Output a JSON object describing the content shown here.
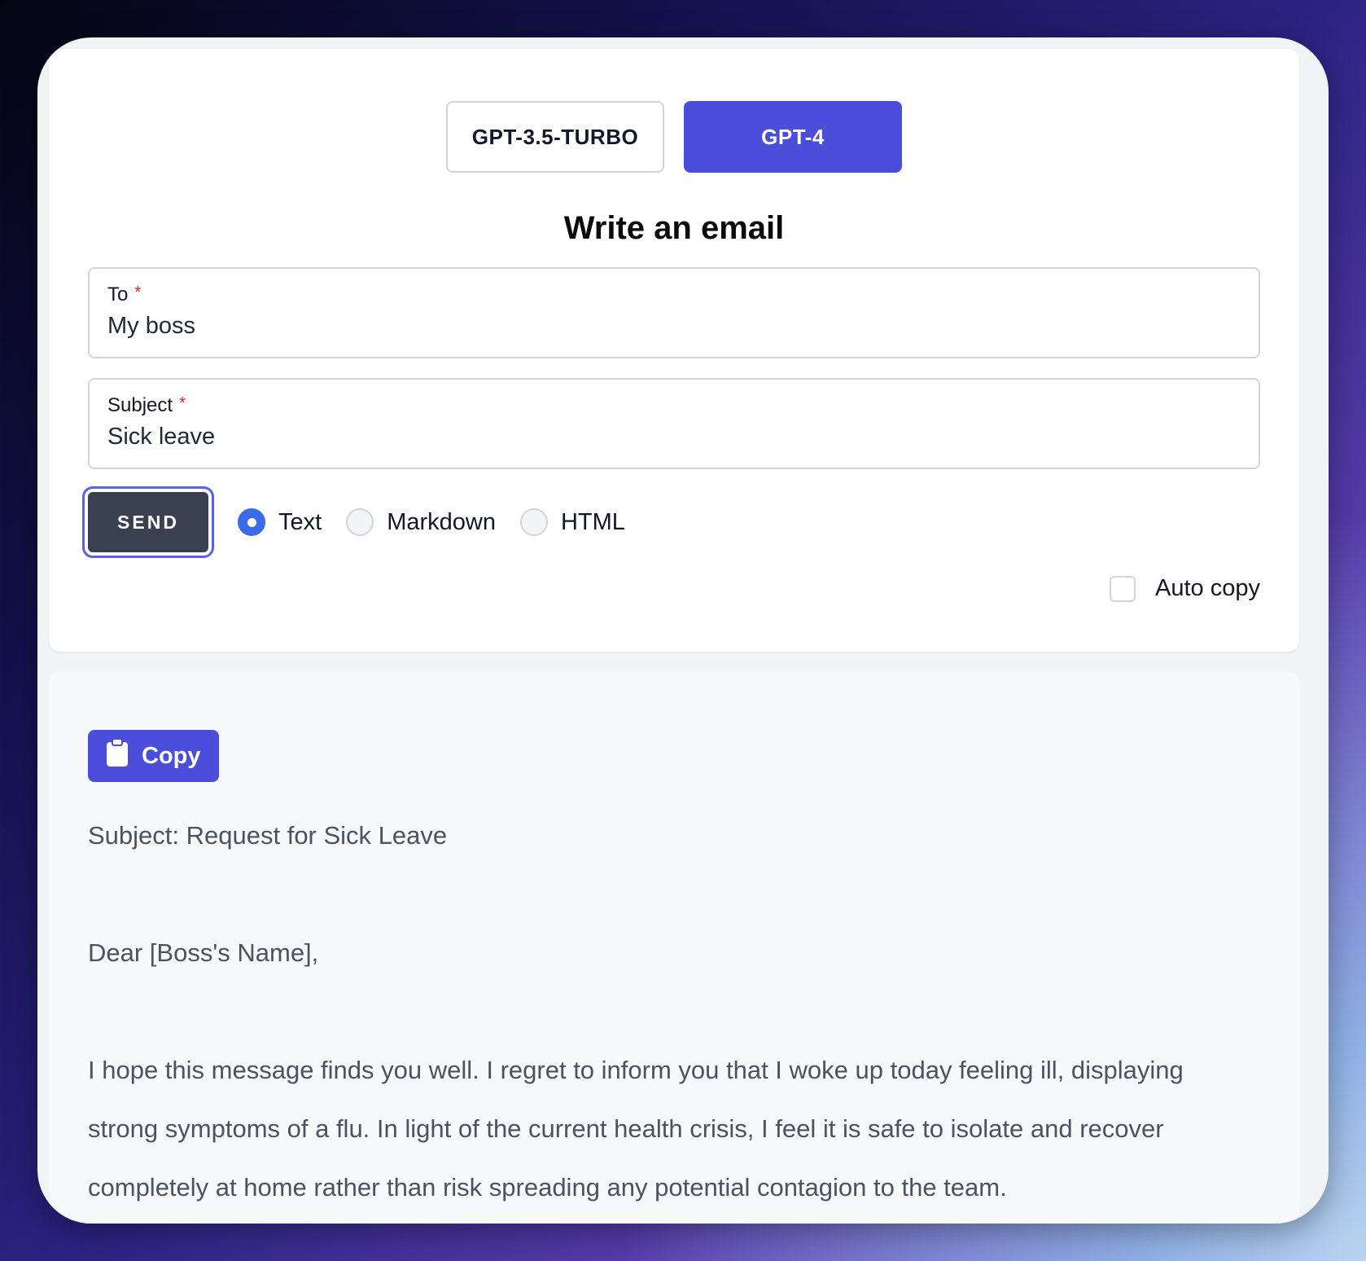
{
  "models": {
    "option_a": "GPT-3.5-TURBO",
    "option_b": "GPT-4",
    "selected": "GPT-4"
  },
  "form": {
    "title": "Write an email",
    "to": {
      "label": "To",
      "required_mark": "*",
      "value": "My boss"
    },
    "subject": {
      "label": "Subject",
      "required_mark": "*",
      "value": "Sick leave"
    },
    "send_label": "SEND",
    "formats": [
      {
        "label": "Text",
        "checked": true
      },
      {
        "label": "Markdown",
        "checked": false
      },
      {
        "label": "HTML",
        "checked": false
      }
    ],
    "auto_copy": {
      "label": "Auto copy",
      "checked": false
    }
  },
  "output": {
    "copy_label": "Copy",
    "paragraphs": [
      "Subject: Request for Sick Leave",
      "Dear [Boss's Name],",
      "I hope this message finds you well. I regret to inform you that I woke up today feeling ill, displaying strong symptoms of a flu. In light of the current health crisis, I feel it is safe to isolate and recover completely at home rather than risk spreading any potential contagion to the team."
    ]
  },
  "colors": {
    "accent": "#4b4edb",
    "send_bg": "#394150",
    "radio_checked": "#3b6be8",
    "required": "#dc2626"
  }
}
